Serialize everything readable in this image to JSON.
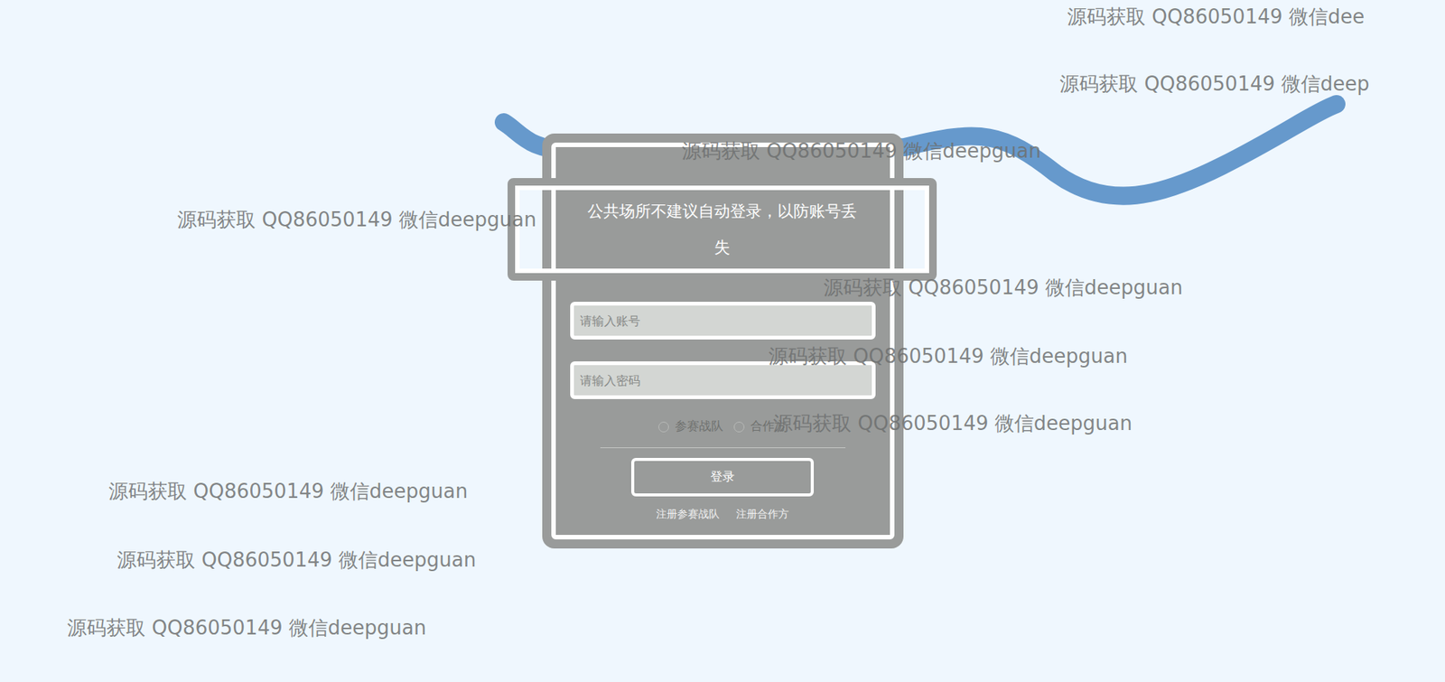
{
  "notice": "公共场所不建议自动登录，以防账号丢失",
  "fields": [
    {
      "placeholder": "请输入账号",
      "type": "text"
    },
    {
      "placeholder": "请输入密码",
      "type": "password"
    }
  ],
  "roles": [
    {
      "label": "参赛战队",
      "selected": false
    },
    {
      "label": "合作方",
      "selected": false
    }
  ],
  "login_button": "登录",
  "links": [
    "注册参赛战队",
    "注册合作方"
  ],
  "watermarks": [
    "源码获取 QQ86050149 微信dee",
    "源码获取 QQ86050149 微信deep",
    "源码获取 QQ86050149 微信deepguan",
    "源码获取 QQ86050149 微信deepguan",
    "源码获取 QQ86050149 微信deepguan",
    "源码获取 QQ86050149 微信deepguan",
    "源码获取 QQ86050149 微信deepguan",
    "源码获取 QQ86050149 微信deepguan",
    "源码获取 QQ86050149 微信deepguan",
    "源码获取 QQ86050149 微信deepguan"
  ]
}
